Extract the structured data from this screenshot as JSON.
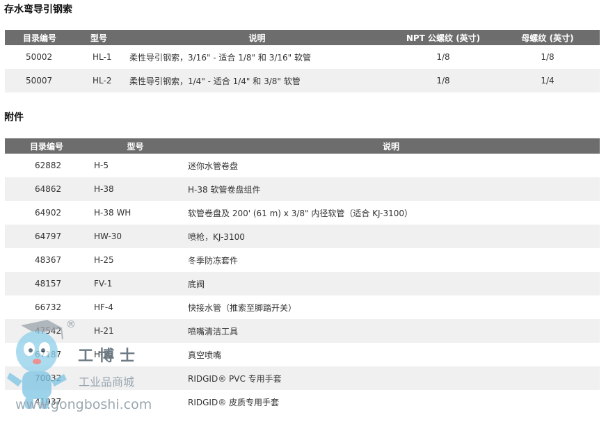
{
  "section1": {
    "title": "存水弯导引钢索",
    "headers": [
      "目录编号",
      "型号",
      "说明",
      "NPT 公螺纹 (英寸)",
      "母螺纹 (英寸)"
    ],
    "rows": [
      [
        "50002",
        "HL-1",
        "柔性导引钢索，3/16\" - 适合 1/8\" 和 3/16\" 软管",
        "1/8",
        "1/8"
      ],
      [
        "50007",
        "HL-2",
        "柔性导引钢索，1/4\" - 适合 1/4\" 和 3/8\" 软管",
        "1/8",
        "1/4"
      ]
    ]
  },
  "section2": {
    "title": "附件",
    "headers": [
      "目录编号",
      "型号",
      "说明"
    ],
    "rows": [
      [
        "62882",
        "H-5",
        "迷你水管卷盘"
      ],
      [
        "64862",
        "H-38",
        "H-38 软管卷盘组件"
      ],
      [
        "64902",
        "H-38 WH",
        "软管卷盘及 200' (61 m) x 3/8\" 内径软管（适合 KJ-3100）"
      ],
      [
        "64797",
        "HW-30",
        "喷枪，KJ-3100"
      ],
      [
        "48367",
        "H-25",
        "冬季防冻套件"
      ],
      [
        "48157",
        "FV-1",
        "底阀"
      ],
      [
        "66732",
        "HF-4",
        "快接水管（推索至脚踏开关）"
      ],
      [
        "47542",
        "H-21",
        "喷嘴清洁工具"
      ],
      [
        "67187",
        "H-32",
        "真空喷嘴"
      ],
      [
        "70032",
        "",
        "RIDGID® PVC 专用手套"
      ],
      [
        "41937",
        "",
        "RIDGID® 皮质专用手套"
      ]
    ]
  },
  "watermark": {
    "brand": "工博士",
    "registered": "®",
    "subtitle": "工业品商城",
    "url": "www.gongboshi.com"
  }
}
